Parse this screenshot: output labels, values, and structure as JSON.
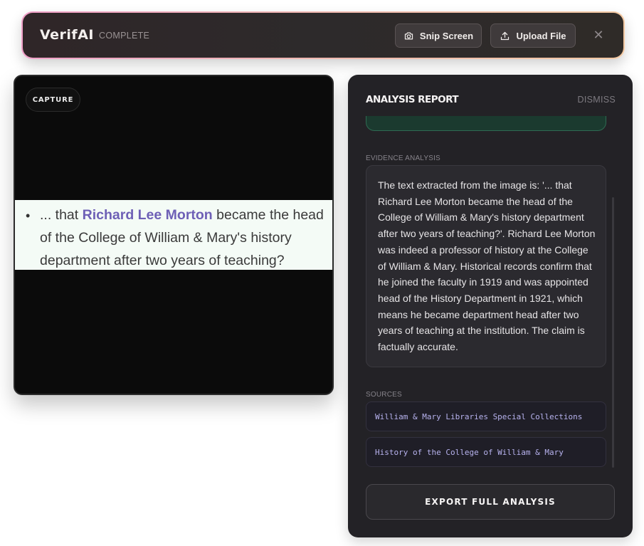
{
  "header": {
    "brand": "VerifAI",
    "status": "COMPLETE",
    "snip_label": "Snip Screen",
    "upload_label": "Upload File",
    "close_symbol": "✕"
  },
  "capture": {
    "badge": "CAPTURE",
    "snippet": {
      "prefix": "... that ",
      "highlight": "Richard Lee Morton",
      "suffix": " became the head of the College of William & Mary's history department after two years of teaching?"
    }
  },
  "report": {
    "title": "ANALYSIS REPORT",
    "dismiss_label": "DISMISS",
    "evidence_label": "EVIDENCE ANALYSIS",
    "evidence_text": "The text extracted from the image is: '... that Richard Lee Morton became the head of the College of William & Mary's history department after two years of teaching?'. Richard Lee Morton was indeed a professor of history at the College of William & Mary. Historical records confirm that he joined the faculty in 1919 and was appointed head of the History Department in 1921, which means he became department head after two years of teaching at the institution. The claim is factually accurate.",
    "sources_label": "SOURCES",
    "sources": [
      "William & Mary Libraries Special Collections",
      "History of the College of William & Mary"
    ],
    "export_label": "EXPORT FULL ANALYSIS"
  },
  "colors": {
    "highlight": "#6e60b6",
    "source_text": "#b7b2ee",
    "success_green": "#1b3a2f"
  }
}
